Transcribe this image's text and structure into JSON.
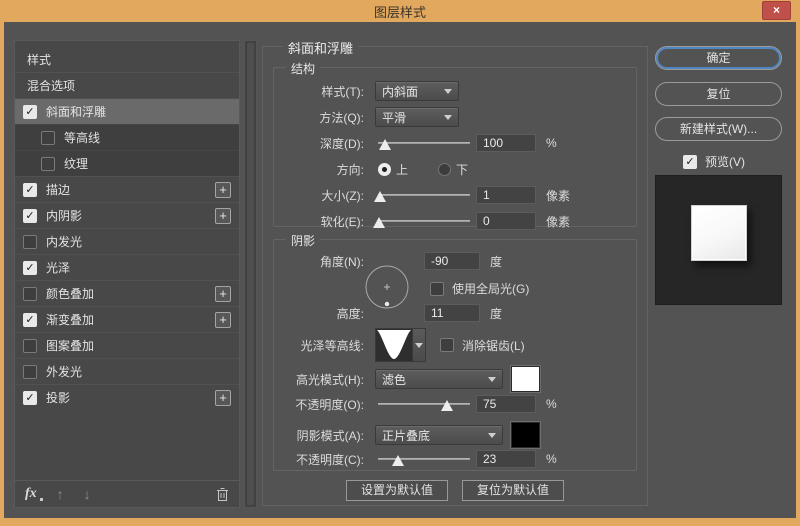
{
  "window": {
    "title": "图层样式"
  },
  "icons": {
    "close": "×",
    "check": "✓",
    "plus": "+",
    "up_arrow": "↑",
    "down_arrow": "↓",
    "fx": "fx"
  },
  "sidebar": {
    "items": [
      {
        "label": "样式"
      },
      {
        "label": "混合选项"
      },
      {
        "label": "斜面和浮雕",
        "checked": true,
        "selected": true
      },
      {
        "label": "等高线",
        "checked": false
      },
      {
        "label": "纹理",
        "checked": false
      },
      {
        "label": "描边",
        "checked": true,
        "plus": true
      },
      {
        "label": "内阴影",
        "checked": true,
        "plus": true
      },
      {
        "label": "内发光",
        "checked": false
      },
      {
        "label": "光泽",
        "checked": true
      },
      {
        "label": "颜色叠加",
        "checked": false,
        "plus": true
      },
      {
        "label": "渐变叠加",
        "checked": true,
        "plus": true
      },
      {
        "label": "图案叠加",
        "checked": false
      },
      {
        "label": "外发光",
        "checked": false
      },
      {
        "label": "投影",
        "checked": true,
        "plus": true
      }
    ]
  },
  "panel": {
    "title": "斜面和浮雕",
    "structure": {
      "legend": "结构",
      "style_label": "样式(T):",
      "style_value": "内斜面",
      "technique_label": "方法(Q):",
      "technique_value": "平滑",
      "depth_label": "深度(D):",
      "depth_value": "100",
      "depth_unit": "%",
      "direction_label": "方向:",
      "direction_up": "上",
      "direction_down": "下",
      "direction_selected": "上",
      "size_label": "大小(Z):",
      "size_value": "1",
      "size_unit": "像素",
      "soften_label": "软化(E):",
      "soften_value": "0",
      "soften_unit": "像素"
    },
    "shading": {
      "legend": "阴影",
      "angle_label": "角度(N):",
      "angle_value": "-90",
      "angle_unit": "度",
      "global_light_label": "使用全局光(G)",
      "global_light_checked": false,
      "altitude_label": "高度:",
      "altitude_value": "11",
      "altitude_unit": "度",
      "gloss_contour_label": "光泽等高线:",
      "anti_alias_label": "消除锯齿(L)",
      "anti_alias_checked": false,
      "highlight_mode_label": "高光模式(H):",
      "highlight_mode_value": "滤色",
      "highlight_color": "#ffffff",
      "highlight_opacity_label": "不透明度(O):",
      "highlight_opacity_value": "75",
      "highlight_opacity_unit": "%",
      "shadow_mode_label": "阴影模式(A):",
      "shadow_mode_value": "正片叠底",
      "shadow_color": "#000000",
      "shadow_opacity_label": "不透明度(C):",
      "shadow_opacity_value": "23",
      "shadow_opacity_unit": "%"
    },
    "footer_buttons": {
      "set_default": "设置为默认值",
      "reset_default": "复位为默认值"
    }
  },
  "actions": {
    "ok": "确定",
    "reset": "复位",
    "new_style": "新建样式(W)...",
    "preview_label": "预览(V)",
    "preview_checked": true
  },
  "colors": {
    "frame": "#e2a95e",
    "close_button": "#c0504a",
    "dialog_bg": "#535353",
    "selected_row": "#6a6a6a",
    "highlight_swatch": "#ffffff",
    "shadow_swatch": "#000000",
    "preview_bg": "#262626"
  }
}
